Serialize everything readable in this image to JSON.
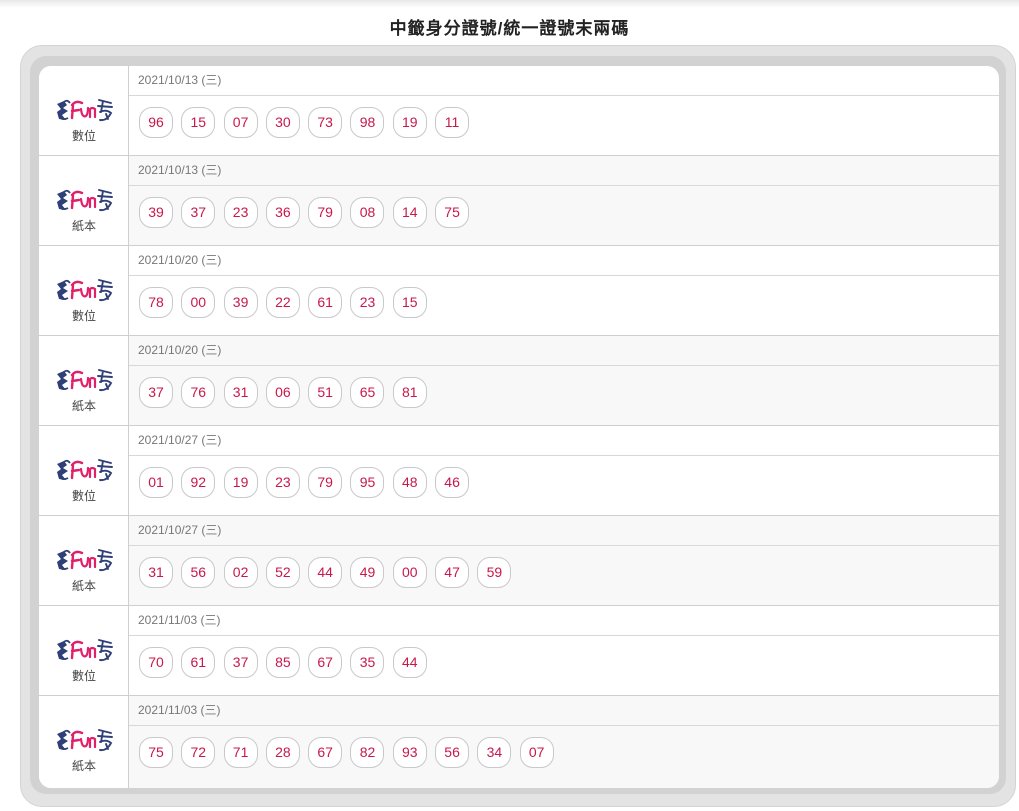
{
  "page": {
    "title": "中籤身分證號/統一證號末兩碼"
  },
  "colors": {
    "number_text": "#c8184a",
    "date_text": "#777777",
    "frame": "#e3e3e3"
  },
  "logo": {
    "icon_name": "fun-logo-icon"
  },
  "rows": [
    {
      "type": "數位",
      "date": "2021/10/13 (三)",
      "numbers": [
        "96",
        "15",
        "07",
        "30",
        "73",
        "98",
        "19",
        "11"
      ]
    },
    {
      "type": "紙本",
      "date": "2021/10/13 (三)",
      "numbers": [
        "39",
        "37",
        "23",
        "36",
        "79",
        "08",
        "14",
        "75"
      ]
    },
    {
      "type": "數位",
      "date": "2021/10/20 (三)",
      "numbers": [
        "78",
        "00",
        "39",
        "22",
        "61",
        "23",
        "15"
      ]
    },
    {
      "type": "紙本",
      "date": "2021/10/20 (三)",
      "numbers": [
        "37",
        "76",
        "31",
        "06",
        "51",
        "65",
        "81"
      ]
    },
    {
      "type": "數位",
      "date": "2021/10/27 (三)",
      "numbers": [
        "01",
        "92",
        "19",
        "23",
        "79",
        "95",
        "48",
        "46"
      ]
    },
    {
      "type": "紙本",
      "date": "2021/10/27 (三)",
      "numbers": [
        "31",
        "56",
        "02",
        "52",
        "44",
        "49",
        "00",
        "47",
        "59"
      ]
    },
    {
      "type": "數位",
      "date": "2021/11/03 (三)",
      "numbers": [
        "70",
        "61",
        "37",
        "85",
        "67",
        "35",
        "44"
      ]
    },
    {
      "type": "紙本",
      "date": "2021/11/03 (三)",
      "numbers": [
        "75",
        "72",
        "71",
        "28",
        "67",
        "82",
        "93",
        "56",
        "34",
        "07"
      ]
    }
  ]
}
